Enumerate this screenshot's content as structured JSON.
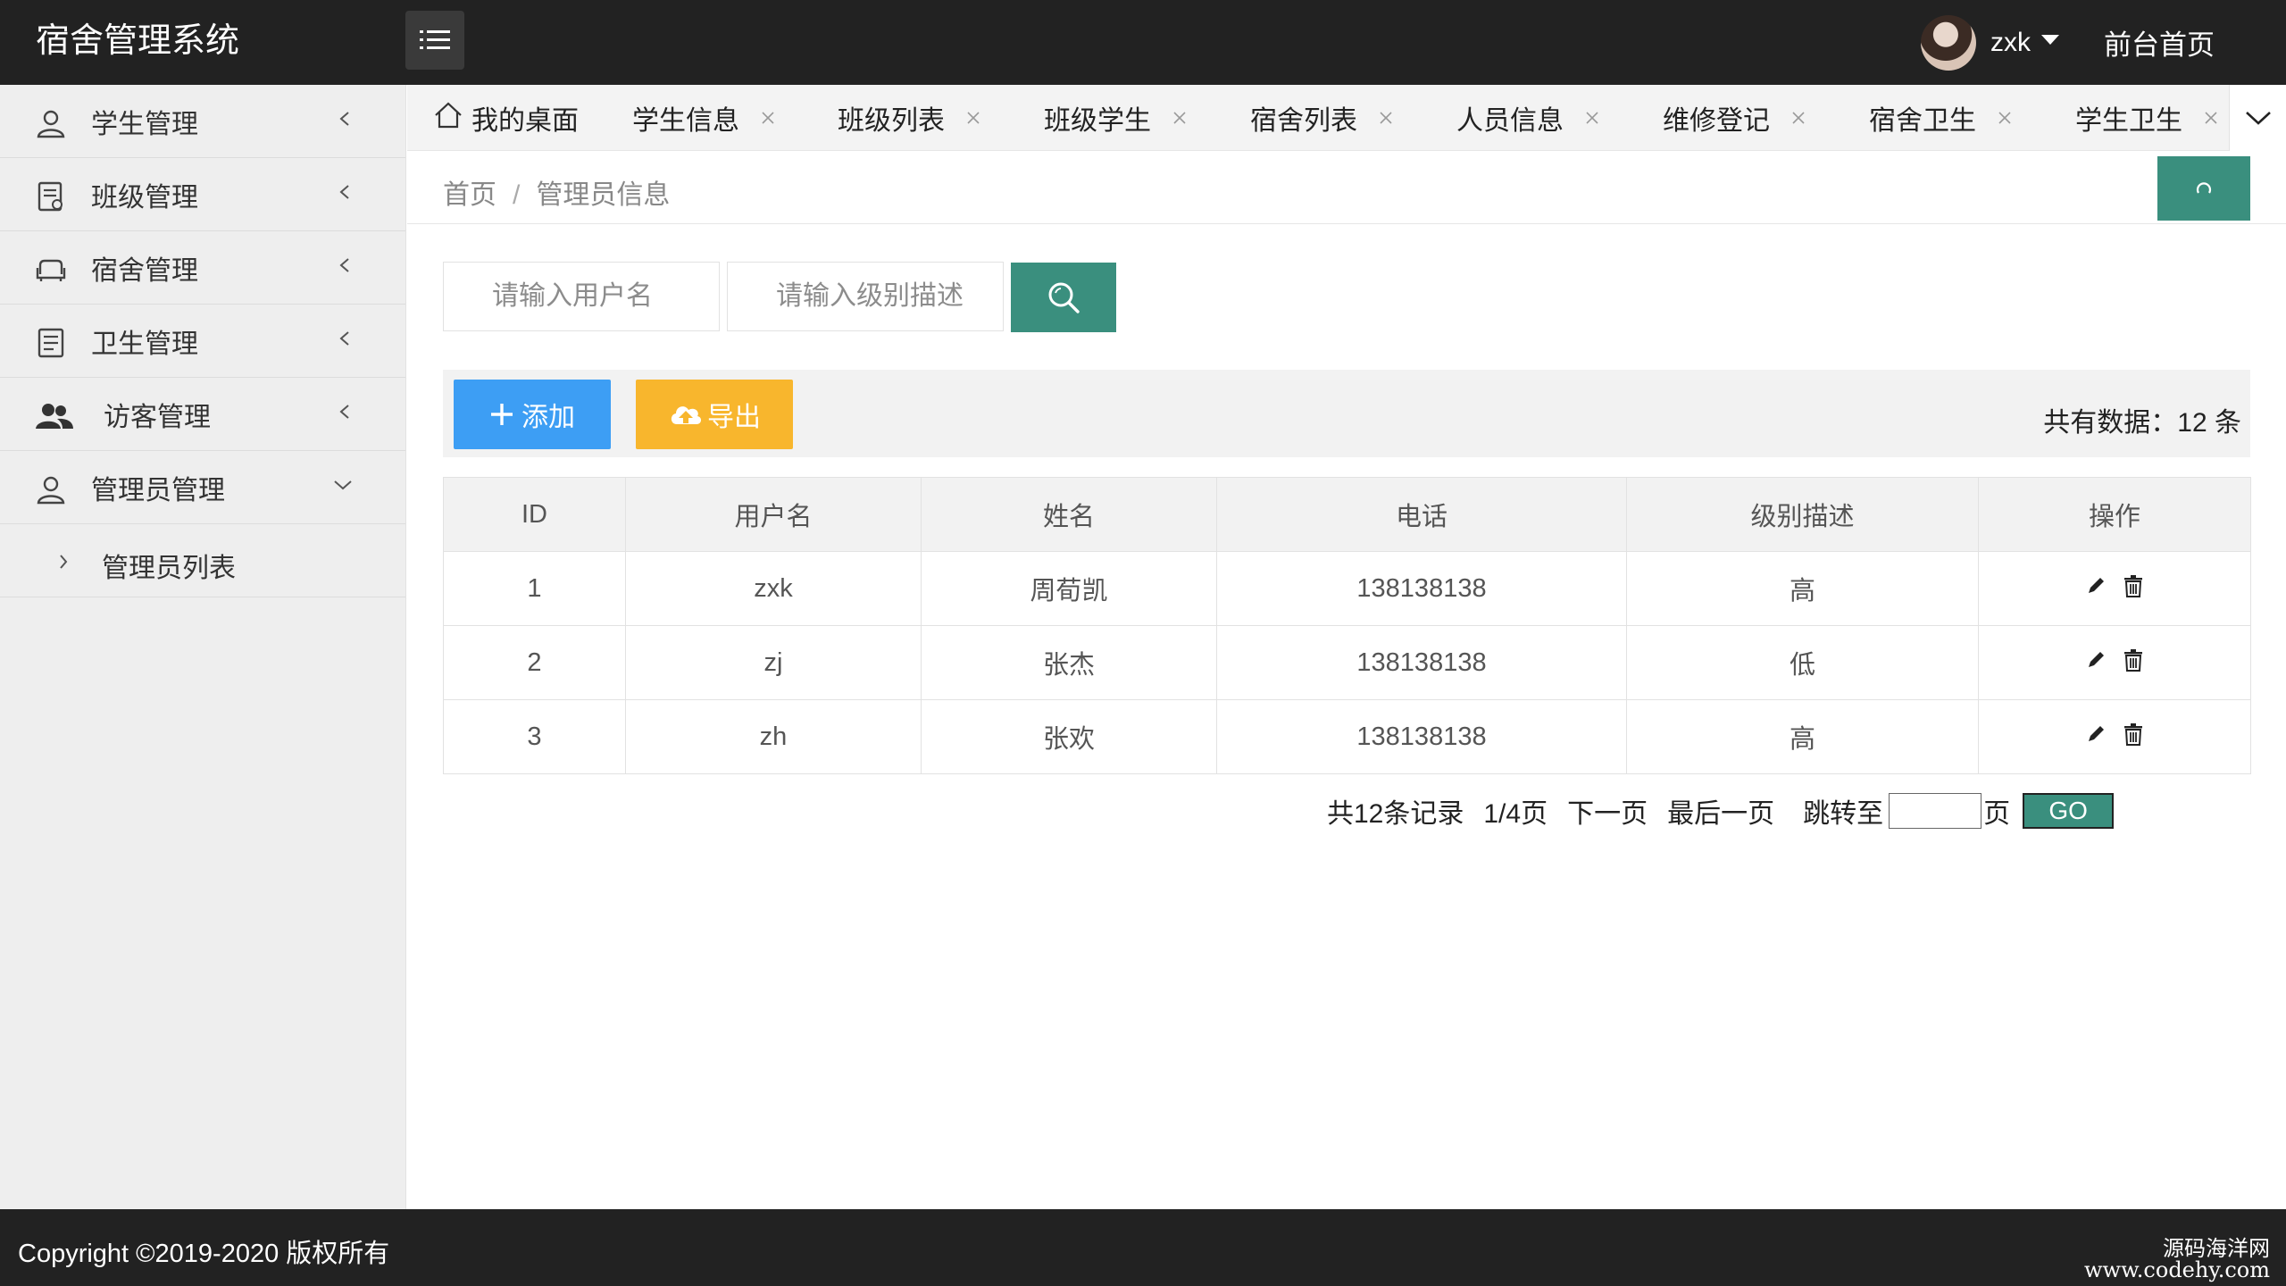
{
  "header": {
    "title": "宿舍管理系统",
    "username": "zxk",
    "frontpage_link": "前台首页"
  },
  "sidebar": {
    "items": [
      {
        "label": "学生管理",
        "icon": "user-icon"
      },
      {
        "label": "班级管理",
        "icon": "document-icon"
      },
      {
        "label": "宿舍管理",
        "icon": "sofa-icon"
      },
      {
        "label": "卫生管理",
        "icon": "list-icon"
      },
      {
        "label": "访客管理",
        "icon": "users-icon"
      },
      {
        "label": "管理员管理",
        "icon": "user-icon"
      }
    ],
    "sub_items": [
      {
        "label": "管理员列表"
      }
    ]
  },
  "tabs": [
    {
      "label": "我的桌面"
    },
    {
      "label": "学生信息"
    },
    {
      "label": "班级列表"
    },
    {
      "label": "班级学生"
    },
    {
      "label": "宿舍列表"
    },
    {
      "label": "人员信息"
    },
    {
      "label": "维修登记"
    },
    {
      "label": "宿舍卫生"
    },
    {
      "label": "学生卫生"
    }
  ],
  "breadcrumb": {
    "home": "首页",
    "separator": "/",
    "current": "管理员信息"
  },
  "search": {
    "username_placeholder": "请输入用户名",
    "level_placeholder": "请输入级别描述"
  },
  "toolbar": {
    "add_label": "添加",
    "export_label": "导出",
    "total_label": "共有数据：12 条"
  },
  "table": {
    "columns": [
      "ID",
      "用户名",
      "姓名",
      "电话",
      "级别描述",
      "操作"
    ],
    "rows": [
      {
        "id": "1",
        "username": "zxk",
        "name": "周荀凯",
        "phone": "138138138",
        "level": "高"
      },
      {
        "id": "2",
        "username": "zj",
        "name": "张杰",
        "phone": "138138138",
        "level": "低"
      },
      {
        "id": "3",
        "username": "zh",
        "name": "张欢",
        "phone": "138138138",
        "level": "高"
      }
    ]
  },
  "pagination": {
    "records": "共12条记录",
    "pages": "1/4页",
    "next": "下一页",
    "last": "最后一页",
    "jump_prefix": "跳转至",
    "jump_suffix": "页",
    "go_label": "GO"
  },
  "footer": {
    "copyright": "Copyright ©2019-2020 版权所有",
    "watermark_line1": "源码海洋网",
    "watermark_line2": "www.codehy.com"
  },
  "colors": {
    "header_bg": "#222222",
    "accent_green": "#3a8f7e",
    "add_blue": "#3d9ef4",
    "export_orange": "#f8b62d"
  }
}
